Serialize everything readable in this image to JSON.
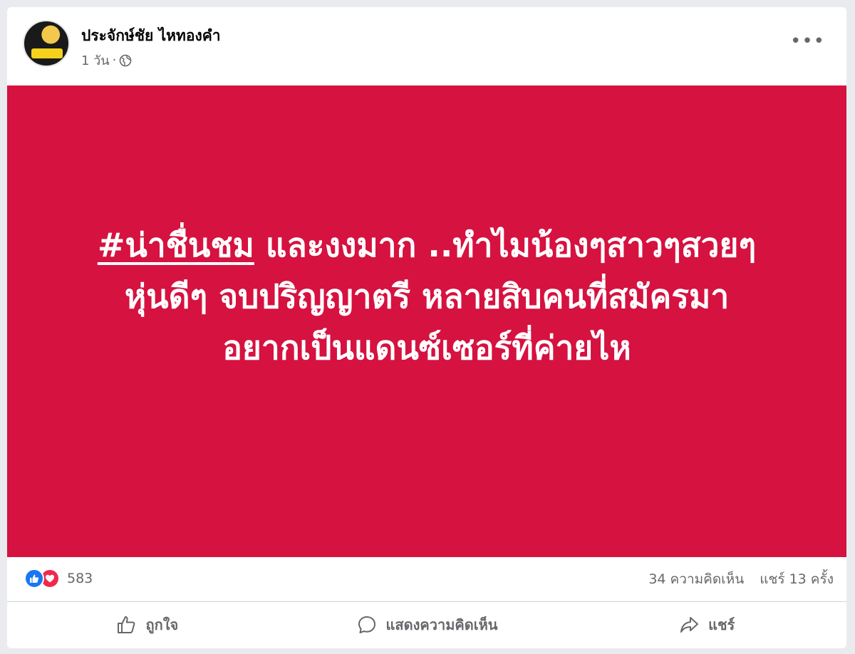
{
  "post": {
    "author": "ประจักษ์ชัย ไหทองคำ",
    "time": "1 วัน",
    "separator": "·",
    "image_bg": "#d51240",
    "hashtag": "#น่าชื่นชม",
    "line1_rest": " และงงมาก ..ทำไมน้องๆสาวๆสวยๆ",
    "line2": "หุ่นดีๆ จบปริญญาตรี หลายสิบคนที่สมัครมา",
    "line3": "อยากเป็นแดนซ์เซอร์ที่ค่ายไห"
  },
  "stats": {
    "reaction_count": "583",
    "comments": "34 ความคิดเห็น",
    "shares": "แชร์ 13 ครั้ง"
  },
  "actions": {
    "like": "ถูกใจ",
    "comment": "แสดงความคิดเห็น",
    "share": "แชร์"
  },
  "icons": {
    "more": "more-options-icon",
    "globe": "globe-icon",
    "like_reaction": "like-reaction-icon",
    "love_reaction": "love-reaction-icon"
  }
}
